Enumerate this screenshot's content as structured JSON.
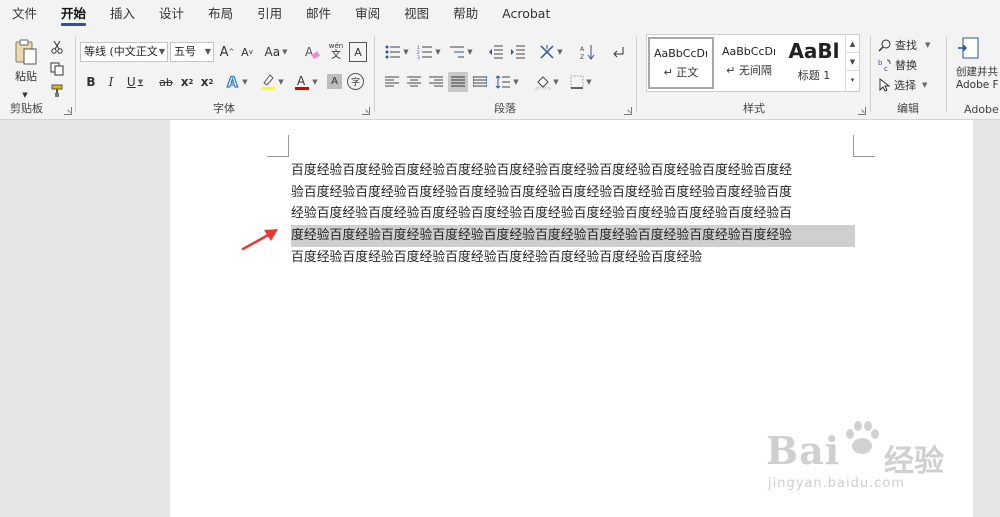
{
  "menu": {
    "tabs": [
      "文件",
      "开始",
      "插入",
      "设计",
      "布局",
      "引用",
      "邮件",
      "审阅",
      "视图",
      "帮助",
      "Acrobat"
    ],
    "active_index": 1
  },
  "ribbon": {
    "clipboard": {
      "label": "剪贴板",
      "paste_label": "粘贴"
    },
    "font": {
      "label": "字体",
      "font_name": "等线 (中文正文",
      "font_size": "五号",
      "grow_label": "A",
      "shrink_label": "A",
      "case_label": "Aa",
      "bold": "B",
      "italic": "I",
      "underline": "U",
      "strike": "ab",
      "subscript": "x",
      "superscript": "x",
      "wen_top": "wén",
      "wen_bottom": "文",
      "border_char": "A",
      "shade_char": "A",
      "circle_char": "字",
      "highlight_color": "#ffff00",
      "font_color": "#e00000"
    },
    "paragraph": {
      "label": "段落"
    },
    "styles": {
      "label": "样式",
      "items": [
        {
          "sample": "AaBbCcDı",
          "name": "正文"
        },
        {
          "sample": "AaBbCcDı",
          "name": "无间隔"
        },
        {
          "sample": "AaBl",
          "name": "标题 1"
        }
      ]
    },
    "editing": {
      "label": "编辑",
      "find": "查找",
      "replace": "替换",
      "select": "选择"
    },
    "adobe": {
      "label": "Adobe",
      "create_line1": "创建并共",
      "create_line2": "Adobe F"
    }
  },
  "document": {
    "lines": [
      "百度经验百度经验百度经验百度经验百度经验百度经验百度经验百度经验百度经验百度经",
      "验百度经验百度经验百度经验百度经验百度经验百度经验百度经验百度经验百度经验百度",
      "经验百度经验百度经验百度经验百度经验百度经验百度经验百度经验百度经验百度经验百",
      "度经验百度经验百度经验百度经验百度经验百度经验百度经验百度经验百度经验百度经验",
      "百度经验百度经验百度经验百度经验百度经验百度经验百度经验百度经验"
    ],
    "selected_line": 3
  },
  "watermark": {
    "brand_latin": "Bai",
    "brand_cn": "经验",
    "url": "jingyan.baidu.com"
  },
  "colors": {
    "accent": "#2b579a",
    "arrow": "#e53935",
    "selection": "#cfcfcf"
  }
}
